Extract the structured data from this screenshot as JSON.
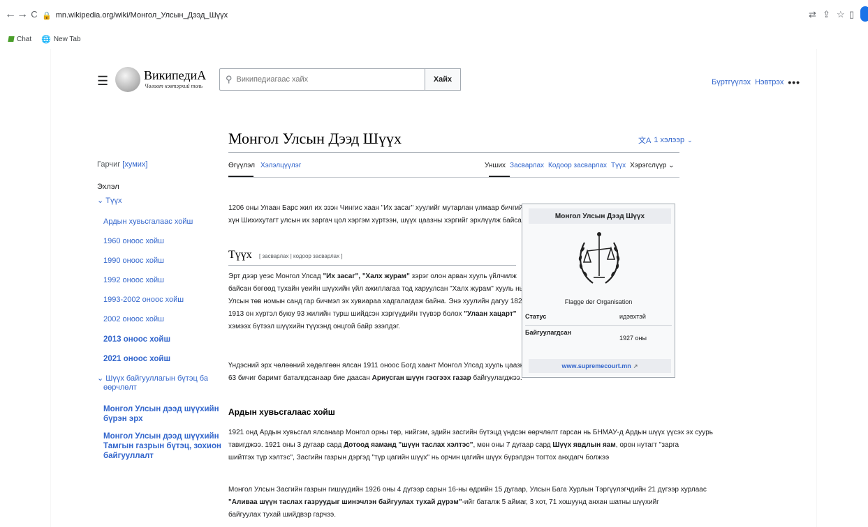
{
  "browser": {
    "url": "mn.wikipedia.org/wiki/Монгол_Улсын_Дээд_Шүүх",
    "back": "←",
    "forward": "→",
    "reload": "C",
    "icons": [
      "translate-icon",
      "share-icon",
      "star-icon",
      "tab-icon",
      "profile-icon"
    ],
    "bookmarks": [
      {
        "label": "Chat",
        "icon": "chat-icon"
      },
      {
        "label": "New Tab",
        "icon": "globe-icon"
      }
    ]
  },
  "header": {
    "logo_word": "ВикипедиА",
    "logo_tagline": "Чөлөөт нэвтэрхий толь",
    "search_placeholder": "Википедиагаас хайх",
    "search_button": "Хайх",
    "create_account": "Бүртгүүлэх",
    "login": "Нэвтрэх",
    "more": "•••"
  },
  "article": {
    "title": "Монгол Улсын Дээд Шүүх",
    "languages": "1 хэлээр",
    "tabs_left": [
      "Өгүүлэл",
      "Хэлэлцүүлэг"
    ],
    "tabs_right": [
      "Унших",
      "Засварлах",
      "Кодоор засварлах",
      "Түүх",
      "Хэрэгслүүр"
    ],
    "intro": {
      "p1_l1": "1206 оны Улаан Барс жил их эзэн Чингис хаан \"Их засаг\" хуулийг мутарлан үлмаар бичгийн их",
      "p1_l2": "хүн Шихихутагт улсын их заргач цол хэргэм хүртээн, шүүх цаазны хэргийг эрхлүүлж байсан."
    },
    "h_tuuh": "Түүх",
    "h_tuuh_edit": "[ засварлах | кодоор засварлах ]",
    "tuuh": {
      "l1a": "Эрт дээр үеэс Монгол Улсад ",
      "l1b": "\"Их засаг\", \"Халх журам\"",
      "l1c": " зэрэг олон арван хууль үйлчилж",
      "l2": "байсан бөгөөд тухайн үеийн шүүхийн үйл ажиллагаа тод харуулсан \"Халх журам\" хууль нь",
      "l3": "Улсын төв номын санд гар бичмэл эх хувиараа хадгалагдаж байна. Энэ хуулийн дагуу 1820-",
      "l4a": "1913 он хүртэл буюу 93 жилийн турш шийдсэн хэргүүдийн түүвэр болох ",
      "l4b": "\"Улаан хацарт\"",
      "l5": "хэмээх бүтээл шүүхийн түүхэнд онцгой байр эзэлдэг.",
      "p2_l1": "Үндэсний эрх чөлөөний хөдөлгөөн ялсан 1911 оноос Богд хаант Монгол Улсад хууль цаазны",
      "p2_l2a": "63 бичиг баримт баталгдсанаар бие даасан ",
      "p2_l2b": "Ариусган шүүн гэсгээх газар",
      "p2_l2c": " байгуулагджээ."
    },
    "h_ardyn": "Ардын хувьсгалаас хойш",
    "ardyn": {
      "p1_l1": "1921 онд Ардын хувьсгал ялсанаар Монгол орны төр, нийгэм, эдийн засгийн бүтэцд үндсэн өөрчлөлт гарсан нь БНМАУ-д Ардын шүүх үүсэх эх суурь",
      "p1_l2a": "тавигджээ. 1921 оны 3 дугаар сард ",
      "p1_l2b": "Дотоод яаманд \"шүүн таслах хэлтэс\"",
      "p1_l2c": ", мөн оны 7 дугаар сард ",
      "p1_l2d": "Шүүх явдлын яам",
      "p1_l2e": ", орон нутагт \"зарга",
      "p1_l3": "шийтгэх түр хэлтэс\", Засгийн газрын дэргэд \"түр цагийн шүүх\" нь орчин цагийн шүүх бүрэлдэн тогтох анхдагч болжээ",
      "p2_l1": "Монгол Улсын Засгийн газрын гишүүдийн 1926 оны 4 дүгээр сарын 16-ны өдрийн 15 дугаар, Улсын Бага Хурлын Тэргүүлэгчдийн 21 дүгээр хурлаас",
      "p2_l2a": "\"Аливаа шүүн таслах газруудыг шинэчлэн байгуулах тухай дүрэм\"",
      "p2_l2b": "-ийг баталж 5 аймаг, 3 хот, 71 хошуунд анхан шатны шүүхийг",
      "p2_l3": "байгуулах тухай шийдвэр гарчээ."
    }
  },
  "toc": {
    "heading": "Гарчиг",
    "hide": "[хумих]",
    "items": [
      {
        "label": "Эхлэл",
        "style": "top"
      },
      {
        "label": "Түүх",
        "style": "section"
      },
      {
        "label": "Ардын хувьсгалаас хойш",
        "style": "sub"
      },
      {
        "label": "1960 оноос хойш",
        "style": "sub"
      },
      {
        "label": "1990 оноос хойш",
        "style": "sub"
      },
      {
        "label": "1992 оноос хойш",
        "style": "sub"
      },
      {
        "label": "1993-2002 оноос хойш",
        "style": "sub"
      },
      {
        "label": "2002 оноос хойш",
        "style": "sub"
      },
      {
        "label": "2013 оноос хойш",
        "style": "subbold"
      },
      {
        "label": "2021 оноос хойш",
        "style": "subbold"
      },
      {
        "label": "Шүүх байгууллагын бүтэц ба",
        "style": "section"
      },
      {
        "label": "өөрчлөлт",
        "style": "cont"
      },
      {
        "label": "Монгол Улсын дээд шүүхийн",
        "style": "subbold"
      },
      {
        "label": "бүрэн эрх",
        "style": "subboldcont"
      },
      {
        "label": "Монгол Улсын дээд шүүхийн",
        "style": "subbold"
      },
      {
        "label": "Тамгын газрын бүтэц, зохион",
        "style": "subboldcont"
      },
      {
        "label": "байгууллалт",
        "style": "subboldcont"
      }
    ]
  },
  "infobox": {
    "title": "Монгол Улсын Дээд Шүүх",
    "caption": "Flagge der Organisation",
    "row1_label": "Статус",
    "row1_value": "идэвхтэй",
    "row2_label": "Байгуулагдсан",
    "row2_value": "1927 оны",
    "website": "www.supremecourt.mn"
  },
  "colors": {
    "link": "#3366cc",
    "text": "#202122",
    "border": "#a2a9b1",
    "infobox_bg": "#f8f9fa"
  }
}
